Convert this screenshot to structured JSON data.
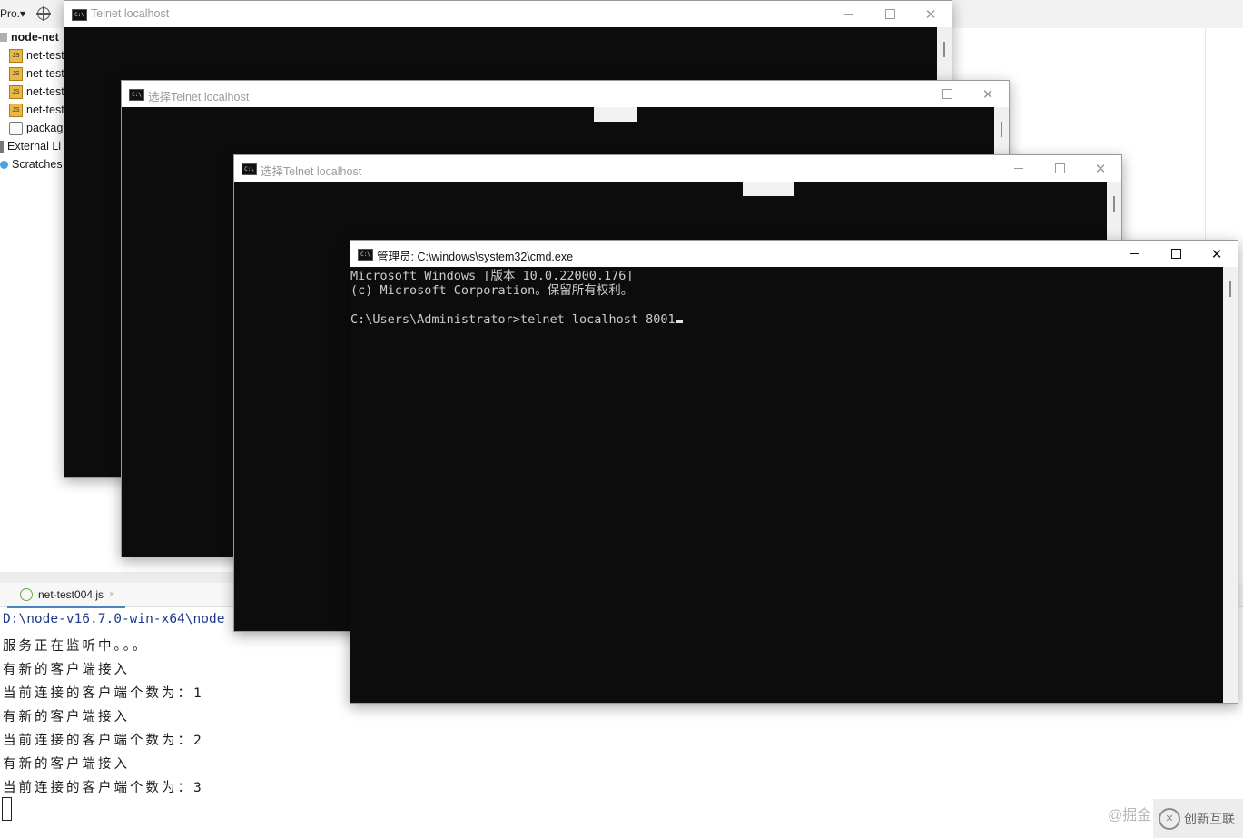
{
  "ide": {
    "project_label": "Pro.▾",
    "tree": {
      "root": "node-net",
      "items": [
        {
          "label": "net-test",
          "icon": "js-file-icon"
        },
        {
          "label": "net-test",
          "icon": "js-file-icon"
        },
        {
          "label": "net-test",
          "icon": "js-file-icon"
        },
        {
          "label": "net-test",
          "icon": "js-file-icon"
        },
        {
          "label": "packag",
          "icon": "package-file-icon"
        },
        {
          "label": "External Li",
          "icon": "library-icon"
        },
        {
          "label": "Scratches",
          "icon": "scratches-icon"
        }
      ]
    },
    "run_tab": {
      "label": "net-test004.js",
      "close": "×"
    },
    "console": {
      "path": "D:\\node-v16.7.0-win-x64\\node",
      "lines": [
        "服务正在监听中。。。",
        "有新的客户端接入",
        "当前连接的客户端个数为：1",
        "有新的客户端接入",
        "当前连接的客户端个数为：2",
        "有新的客户端接入",
        "当前连接的客户端个数为：3"
      ]
    },
    "watermark": "@掘金",
    "brand": "创新互联",
    "brand_logo": "✕"
  },
  "windows": {
    "w1": {
      "title": "Telnet localhost",
      "icon_text": "C:\\"
    },
    "w2": {
      "title": "选择Telnet localhost",
      "icon_text": "C:\\"
    },
    "w3": {
      "title": "选择Telnet localhost",
      "icon_text": "C:\\"
    },
    "cmd": {
      "title": "管理员: C:\\windows\\system32\\cmd.exe",
      "icon_text": "C:\\",
      "lines": [
        "Microsoft Windows [版本 10.0.22000.176]",
        "(c) Microsoft Corporation。保留所有权利。",
        "",
        "C:\\Users\\Administrator>telnet localhost 8001"
      ]
    }
  },
  "controls": {
    "minimize": "—",
    "maximize": "☐",
    "close": "✕"
  }
}
